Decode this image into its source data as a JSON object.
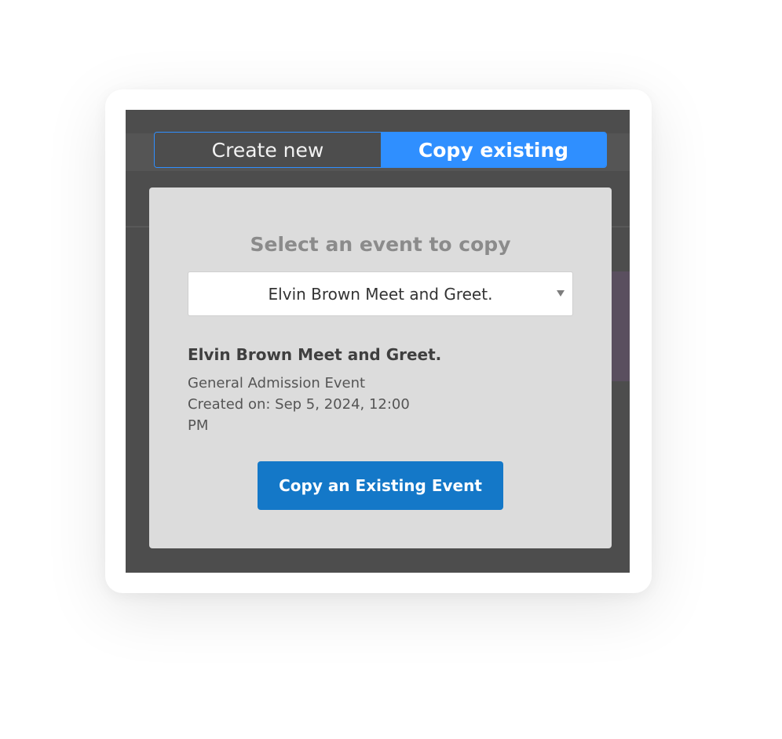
{
  "tabs": {
    "create_new": "Create new",
    "copy_existing": "Copy existing",
    "active": "copy_existing"
  },
  "panel": {
    "heading": "Select an event to copy",
    "selected_event": "Elvin Brown Meet and Greet.",
    "details": {
      "title": "Elvin Brown Meet and Greet.",
      "type": "General Admission Event",
      "created": "Created on: Sep 5, 2024, 12:00 PM"
    },
    "copy_button_label": "Copy an Existing Event"
  },
  "colors": {
    "accent": "#2f8fff",
    "button": "#1478c8",
    "overlay": "#4d4d4d",
    "panel": "#dcdcdc"
  }
}
